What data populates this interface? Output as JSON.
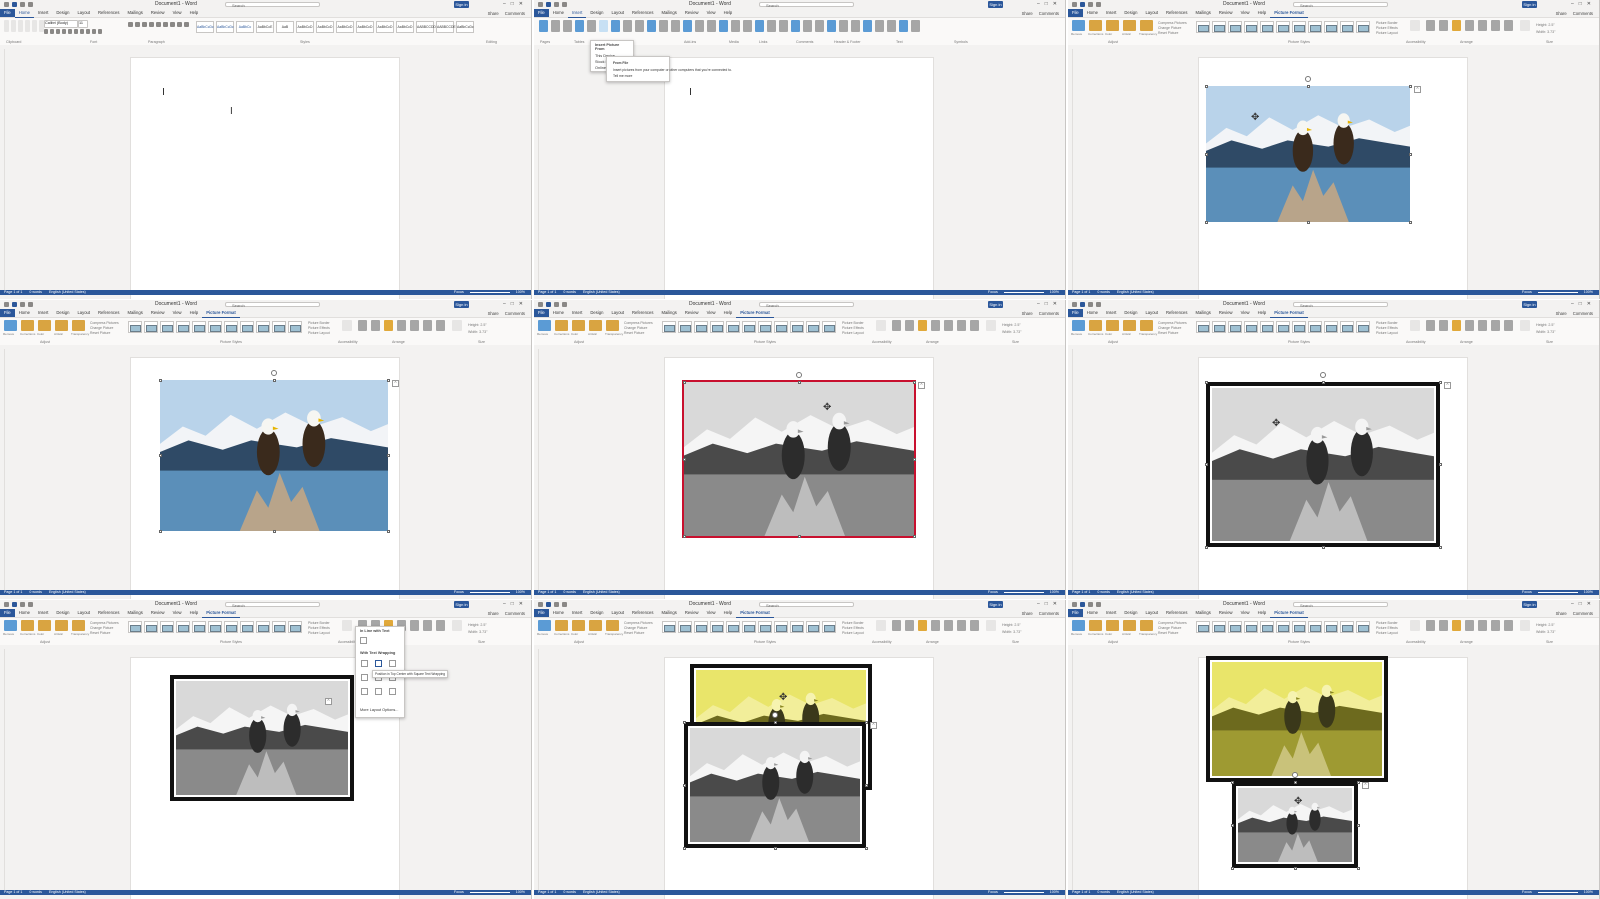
{
  "app": {
    "document_title": "Document1 - Word",
    "search_placeholder": "Search",
    "sign_in": "Sign in",
    "share": "Share",
    "comments": "Comments",
    "file_tab": "File",
    "tabs": [
      "Home",
      "Insert",
      "Design",
      "Layout",
      "References",
      "Mailings",
      "Review",
      "View",
      "Help"
    ],
    "context_tab": "Picture Format",
    "status": {
      "page": "Page 1 of 1",
      "words": "0 words",
      "lang": "English (United States)",
      "focus": "Focus",
      "zoom": "100%"
    }
  },
  "ribbons": {
    "home": {
      "font_name": "Calibri (Body)",
      "font_size": "11",
      "groups": [
        "Clipboard",
        "Font",
        "Paragraph",
        "Styles",
        "Editing"
      ],
      "styles": [
        "AaBbCcDc",
        "AaBbCcDc",
        "AaBbCc",
        "AaBbCcE",
        "AaB",
        "AaBbCcD",
        "AaBbCcD",
        "AaBbCcD",
        "AaBbCcD",
        "AaBbCcD",
        "AaBbCcD",
        "AABBCCDD",
        "AABBCCDE",
        "AaBbCcDc"
      ]
    },
    "insert": {
      "groups": [
        "Pages",
        "Tables",
        "Illustrations",
        "Add-ins",
        "Media",
        "Links",
        "Comments",
        "Header & Footer",
        "Text",
        "Symbols"
      ],
      "picture_menu": {
        "header": "Insert Picture From",
        "items": [
          "This Device...",
          "Stock Images...",
          "Online Pictures..."
        ],
        "tooltip_title": "From File",
        "tooltip_text": "Insert pictures from your computer or other computers that you're connected to.",
        "more": "Tell me more"
      }
    },
    "picture": {
      "buttons": [
        "Remove Background",
        "Corrections",
        "Color",
        "Artistic Effects",
        "Transparency"
      ],
      "checks": [
        "Compress Pictures",
        "Change Picture",
        "Reset Picture"
      ],
      "border": "Picture Border",
      "effects": "Picture Effects",
      "layout": "Picture Layout",
      "groups": [
        "Adjust",
        "Picture Styles",
        "Accessibility",
        "Arrange",
        "Size"
      ],
      "alt_text": "Alt Text",
      "height_label": "Height:",
      "height_value": "2.5\"",
      "width_label": "Width:",
      "width_value": "3.73\"",
      "crop": "Crop",
      "arrange": [
        "Position",
        "Wrap Text",
        "Bring Forward",
        "Send Backward",
        "Selection Pane",
        "Align",
        "Group",
        "Rotate"
      ]
    }
  },
  "wrap_menu": {
    "inline": "In Line with Text",
    "with_wrap": "With Text Wrapping",
    "tooltip": "Position in Top Center with Square Text Wrapping",
    "see_more": "More Layout Options..."
  },
  "colors": {
    "word_blue": "#2b579a",
    "selection_red": "#c8102e",
    "frame_black": "#111111",
    "yellow_tint": "#e9e56a",
    "sky": "#b9d3ea",
    "water": "#5b8fb9"
  }
}
